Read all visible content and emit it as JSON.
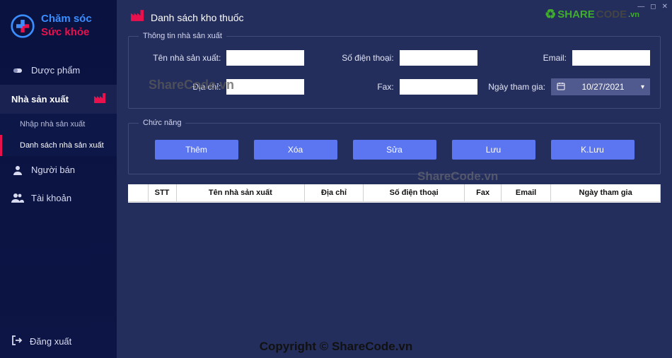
{
  "brand": {
    "line1": "Chăm sóc",
    "line2": "Sức khỏe"
  },
  "sidebar": {
    "items": [
      {
        "label": "Dược phẩm"
      },
      {
        "label": "Nhà sản xuất"
      },
      {
        "label": "Người bán"
      },
      {
        "label": "Tài khoản"
      }
    ],
    "sub": [
      {
        "label": "Nhập nhà sản xuất"
      },
      {
        "label": "Danh sách nhà sản xuất"
      }
    ],
    "logout": "Đăng xuất"
  },
  "page": {
    "title": "Danh sách kho thuốc"
  },
  "group_info": {
    "legend": "Thông tin nhà sản xuất",
    "fields": {
      "name": "Tên nhà sản xuất:",
      "phone": "Số điện thoại:",
      "email": "Email:",
      "address": "Địa chỉ:",
      "fax": "Fax:",
      "join_date": "Ngày tham gia:"
    },
    "values": {
      "name": "",
      "phone": "",
      "email": "",
      "address": "",
      "fax": "",
      "join_date": "10/27/2021"
    }
  },
  "group_actions": {
    "legend": "Chức năng",
    "buttons": {
      "add": "Thêm",
      "delete": "Xóa",
      "edit": "Sửa",
      "save": "Lưu",
      "nosave": "K.Lưu"
    }
  },
  "table": {
    "headers": [
      "",
      "STT",
      "Tên nhà sản xuất",
      "Địa chỉ",
      "Số điện thoại",
      "Fax",
      "Email",
      "Ngày tham gia"
    ]
  },
  "watermarks": {
    "wm1": "ShareCode.vn",
    "wm2": "ShareCode.vn",
    "footer": "Copyright © ShareCode.vn",
    "badge_share": "SHARE",
    "badge_code": "CODE",
    "badge_vn": ".vn"
  },
  "colors": {
    "accent": "#e8114d",
    "primary_btn": "#5b76f0",
    "bg": "#242e5c"
  }
}
